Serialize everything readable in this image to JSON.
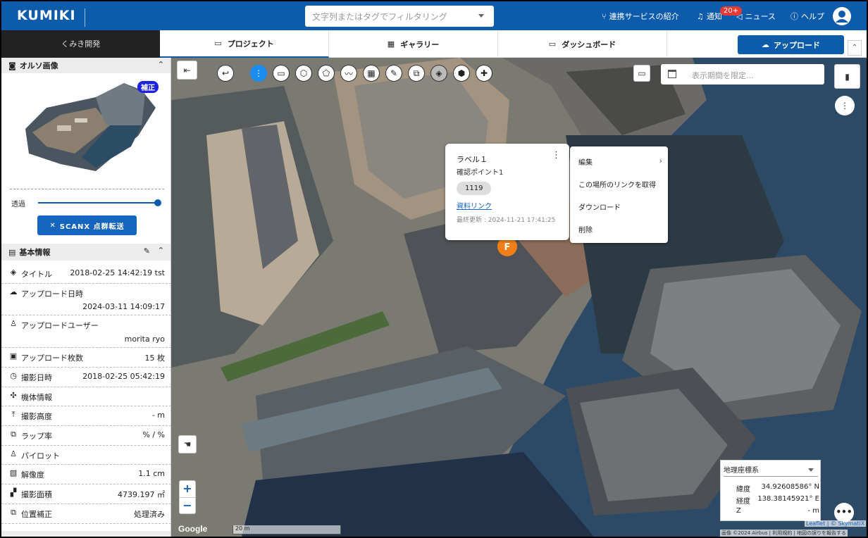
{
  "header": {
    "logo": "KUMIKI",
    "search_placeholder": "文字列またはタグでフィルタリング",
    "nav": {
      "services": "連携サービスの紹介",
      "notifications": "通知",
      "notification_count": "20+",
      "news": "ニュース",
      "help": "ヘルプ"
    }
  },
  "subbar": {
    "project_name": "くみき開発",
    "tabs": [
      "プロジェクト",
      "ギャラリー",
      "ダッシュボード"
    ],
    "upload_label": "アップロード"
  },
  "sidebar": {
    "ortho_title": "オルソ画像",
    "correction_badge": "補正",
    "opacity_label": "透過",
    "opacity_value": 1.0,
    "scanx_label": "SCANX 点群転送",
    "basic_info_title": "基本情報",
    "rows": [
      {
        "label": "タイトル",
        "value": "2018-02-25 14:42:19 tst"
      },
      {
        "label": "アップロード日時",
        "value": "2024-03-11 14:09:17"
      },
      {
        "label": "アップロードユーザー",
        "value": "morita ryo"
      },
      {
        "label": "アップロード枚数",
        "value": "15 枚"
      },
      {
        "label": "撮影日時",
        "value": "2018-02-25 05:42:19"
      },
      {
        "label": "機体情報",
        "value": ""
      },
      {
        "label": "撮影高度",
        "value": "- m"
      },
      {
        "label": "ラップ率",
        "value": "% / %"
      },
      {
        "label": "パイロット",
        "value": ""
      },
      {
        "label": "解像度",
        "value": "1.1 cm"
      },
      {
        "label": "撮影面積",
        "value": "4739.197 ㎡"
      },
      {
        "label": "位置補正",
        "value": "処理済み"
      }
    ]
  },
  "map": {
    "period_placeholder": "表示期間を限定...",
    "popup": {
      "title": "ラベル１",
      "subtitle": "確認ポイント1",
      "chip": "1119",
      "link": "資料リンク",
      "updated": "最終更新 : 2024-11-21 17:41:25"
    },
    "context_menu": [
      "編集",
      "この場所のリンクを取得",
      "ダウンロード",
      "削除"
    ],
    "coords": {
      "system": "地理座標系",
      "lat_label": "緯度",
      "lat": "34.92608586° N",
      "lng_label": "経度",
      "lng": "138.38145921° E",
      "z_label": "Z",
      "z": "- m"
    },
    "zoom_in": "+",
    "zoom_out": "−",
    "google": "Google",
    "scale": "20 m",
    "attribution": "Leaflet | © SkymatiX",
    "attribution2": "画像 ©2024 Airbus | 利用規約 | 地図の誤りを報告する",
    "more": "•••"
  }
}
